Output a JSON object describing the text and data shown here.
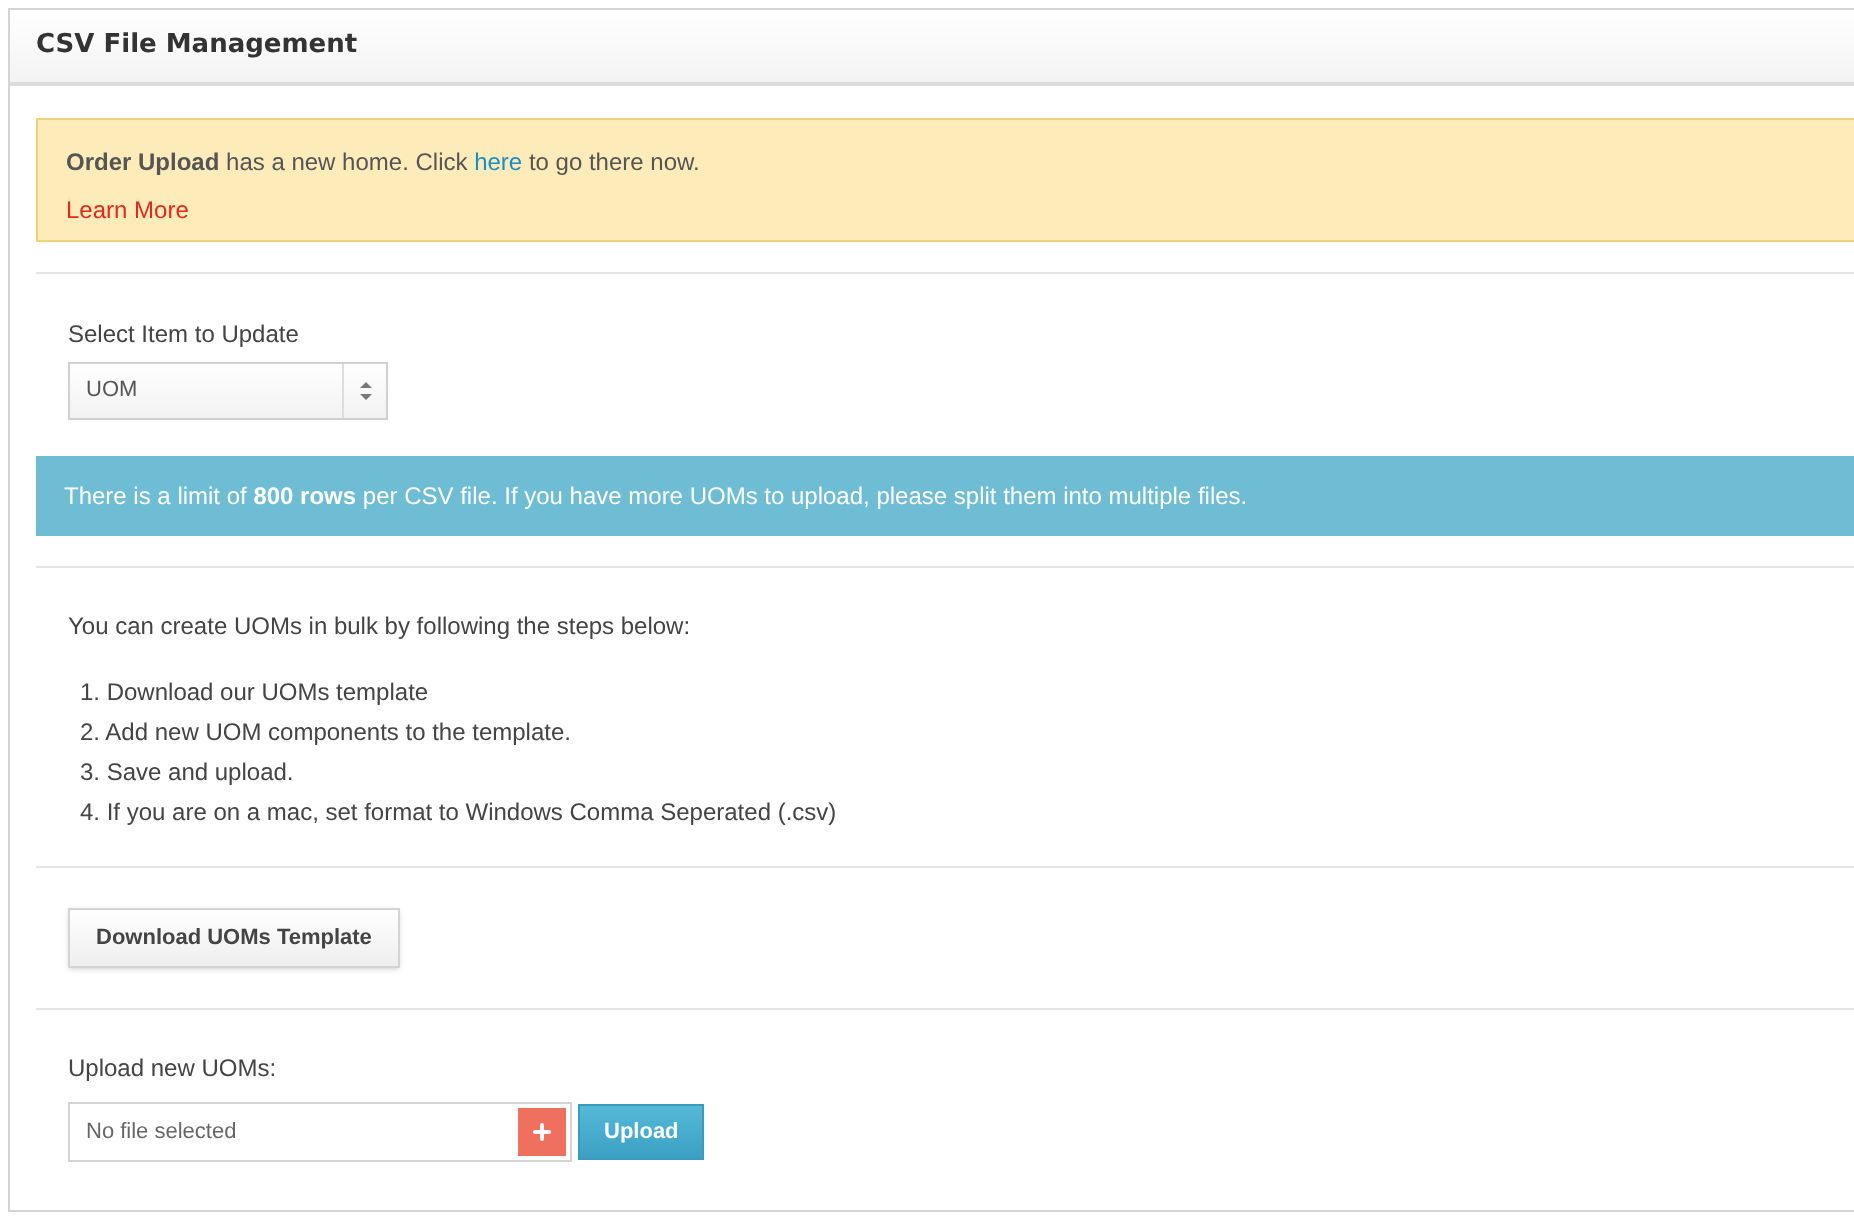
{
  "panel": {
    "title": "CSV File Management"
  },
  "notice": {
    "message_before": "**Order Upload** has a new home. Click ",
    "link": "here",
    "message_after": " to go there now.",
    "learn_more": "Learn More"
  },
  "item_select": {
    "label": "Select Item to Update",
    "value": "UOM"
  },
  "limit_banner": "There is a limit of **800 rows** per CSV file. If you have more UOMs to upload, please split them into multiple files.",
  "instructions": {
    "intro": "You can create UOMs in bulk by following the steps below:",
    "steps": [
      "1. Download our UOMs template",
      "2. Add new UOM components to the template.",
      "3. Save and upload.",
      "4. If you are on a mac, set format to Windows Comma Seperated (.csv)"
    ]
  },
  "download_button": "Download UOMs Template",
  "upload": {
    "label": "Upload new UOMs:",
    "placeholder": "No file selected",
    "button": "Upload"
  }
}
